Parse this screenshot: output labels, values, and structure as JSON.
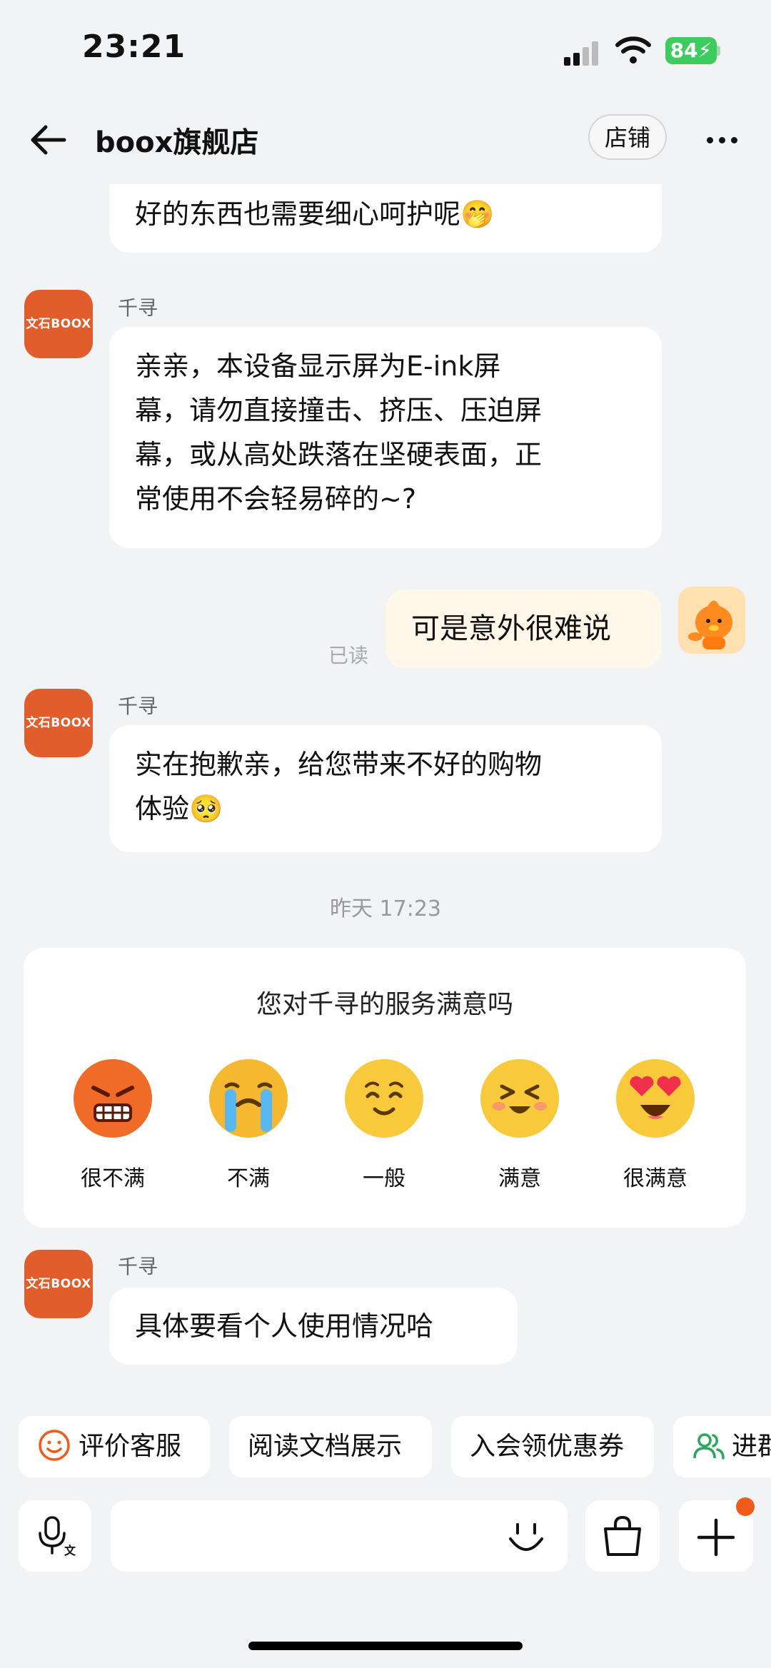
{
  "status": {
    "time": "23:21",
    "battery": "84"
  },
  "header": {
    "title": "boox旗舰店",
    "store_label": "店铺"
  },
  "avatar_text": "文石BOOX",
  "messages": {
    "m0": "好的东西也需要细心呵护呢🤭",
    "m1_sender": "千寻",
    "m1_lines": [
      "亲亲，本设备显示屏为E-ink屏",
      "幕，请勿直接撞击、挤压、压迫屏",
      "幕，或从高处跌落在坚硬表面，正",
      "常使用不会轻易碎的~?"
    ],
    "m2": "可是意外很难说",
    "m2_status": "已读",
    "m3_sender": "千寻",
    "m3_lines": [
      "实在抱歉亲，给您带来不好的购物",
      "体验🥺"
    ],
    "timestamp": "昨天 17:23",
    "m4_sender": "千寻",
    "m4": "具体要看个人使用情况哈"
  },
  "survey": {
    "title": "您对千寻的服务满意吗",
    "options": [
      {
        "label": "很不满",
        "icon": "angry-face-icon",
        "color": "#f06a28"
      },
      {
        "label": "不满",
        "icon": "crying-face-icon",
        "color": "#f5b830"
      },
      {
        "label": "一般",
        "icon": "content-face-icon",
        "color": "#f8c93a"
      },
      {
        "label": "满意",
        "icon": "grinning-face-icon",
        "color": "#f8c93a"
      },
      {
        "label": "很满意",
        "icon": "heart-eyes-face-icon",
        "color": "#f8c93a"
      }
    ]
  },
  "quick_actions": [
    "评价客服",
    "阅读文档展示",
    "入会领优惠券",
    "进群"
  ],
  "colors": {
    "accent": "#f05a1a",
    "brand": "#e25d2c",
    "battery": "#3ecb5f"
  }
}
